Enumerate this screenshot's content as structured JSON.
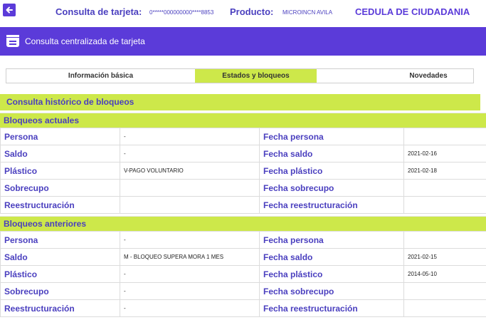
{
  "header": {
    "card_label": "Consulta de tarjeta:",
    "card_number": "0*****000000000****8853",
    "product_label": "Producto:",
    "product_value": "MICROINCN AVILA",
    "document_type": "CEDULA DE CIUDADANIA"
  },
  "banner": {
    "title": "Consulta centralizada de tarjeta"
  },
  "tabs": [
    {
      "label": "Información básica",
      "active": false
    },
    {
      "label": "Estados y bloqueos",
      "active": true
    },
    {
      "label": "",
      "active": false
    },
    {
      "label": "Novedades",
      "active": false
    }
  ],
  "section_title": "Consulta histórico de bloqueos",
  "bloqueos_actuales": {
    "title": "Bloqueos actuales",
    "rows": [
      {
        "label": "Persona",
        "value": "-",
        "date_label": "Fecha persona",
        "date": ""
      },
      {
        "label": "Saldo",
        "value": "-",
        "date_label": "Fecha saldo",
        "date": "2021-02-16"
      },
      {
        "label": "Plástico",
        "value": "V-PAGO VOLUNTARIO",
        "date_label": "Fecha plástico",
        "date": "2021-02-18"
      },
      {
        "label": "Sobrecupo",
        "value": "",
        "date_label": "Fecha sobrecupo",
        "date": ""
      },
      {
        "label": "Reestructuración",
        "value": "",
        "date_label": "Fecha reestructuración",
        "date": ""
      }
    ]
  },
  "bloqueos_anteriores": {
    "title": "Bloqueos anteriores",
    "rows": [
      {
        "label": "Persona",
        "value": "-",
        "date_label": "Fecha persona",
        "date": ""
      },
      {
        "label": "Saldo",
        "value": "M - BLOQUEO SUPERA MORA 1 MES",
        "date_label": "Fecha saldo",
        "date": "2021-02-15"
      },
      {
        "label": "Plástico",
        "value": "-",
        "date_label": "Fecha plástico",
        "date": "2014-05-10"
      },
      {
        "label": "Sobrecupo",
        "value": "-",
        "date_label": "Fecha sobrecupo",
        "date": ""
      },
      {
        "label": "Reestructuración",
        "value": "-",
        "date_label": "Fecha reestructuración",
        "date": ""
      }
    ]
  },
  "colors": {
    "primary": "#5b3bd9",
    "accent": "#cde84a",
    "label_text": "#4a3fbf"
  },
  "icons": {
    "back": "arrow-left-icon",
    "banner": "card-list-icon"
  }
}
